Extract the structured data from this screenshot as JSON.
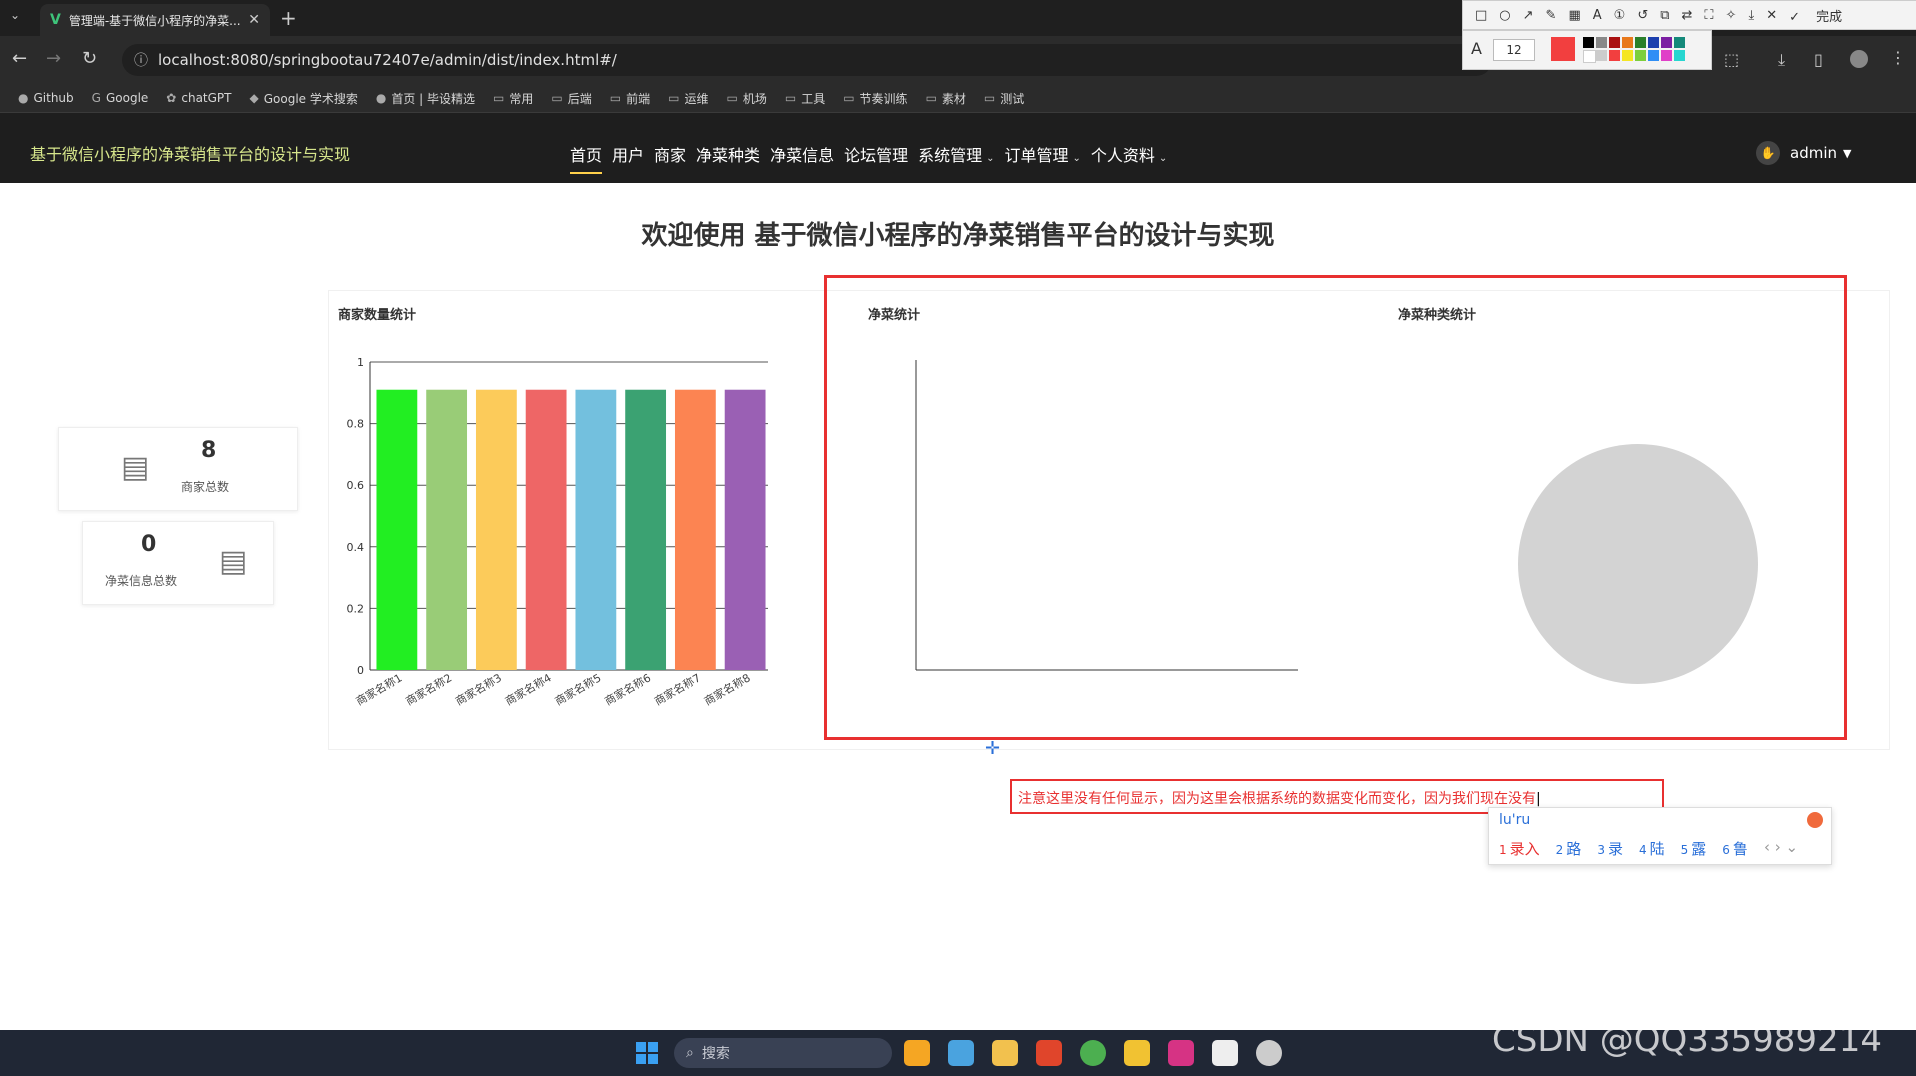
{
  "browser": {
    "tab_title": "管理端-基于微信小程序的净菜...",
    "tab_icon": "V",
    "url": "localhost:8080/springbootau72407e/admin/dist/index.html#/",
    "bookmarks": [
      "Github",
      "Google",
      "chatGPT",
      "Google 学术搜索",
      "首页 | 毕设精选",
      "常用",
      "后端",
      "前端",
      "运维",
      "机场",
      "工具",
      "节奏训练",
      "素材",
      "测试"
    ]
  },
  "annotation_tool": {
    "done_label": "完成",
    "font_size": "12"
  },
  "app": {
    "title": "基于微信小程序的净菜销售平台的设计与实现",
    "nav": [
      {
        "label": "首页",
        "dropdown": false,
        "active": true
      },
      {
        "label": "用户",
        "dropdown": false
      },
      {
        "label": "商家",
        "dropdown": false
      },
      {
        "label": "净菜种类",
        "dropdown": false
      },
      {
        "label": "净菜信息",
        "dropdown": false
      },
      {
        "label": "论坛管理",
        "dropdown": false
      },
      {
        "label": "系统管理",
        "dropdown": true
      },
      {
        "label": "订单管理",
        "dropdown": true
      },
      {
        "label": "个人资料",
        "dropdown": true
      }
    ],
    "user": "admin"
  },
  "main": {
    "welcome": "欢迎使用 基于微信小程序的净菜销售平台的设计与实现",
    "stats": [
      {
        "value": "8",
        "label": "商家总数"
      },
      {
        "value": "0",
        "label": "净菜信息总数"
      }
    ],
    "panels": {
      "merchant": "商家数量统计",
      "veg": "净菜统计",
      "vegtype": "净菜种类统计"
    },
    "note": "注意这里没有任何显示，因为这里会根据系统的数据变化而变化，因为我们现在没有",
    "ime": {
      "pinyin": "lu'ru",
      "candidates": [
        {
          "n": "1",
          "text": "录入"
        },
        {
          "n": "2",
          "text": "路"
        },
        {
          "n": "3",
          "text": "录"
        },
        {
          "n": "4",
          "text": "陆"
        },
        {
          "n": "5",
          "text": "露"
        },
        {
          "n": "6",
          "text": "鲁"
        }
      ]
    }
  },
  "chart_data": [
    {
      "type": "bar",
      "title": "商家数量统计",
      "categories": [
        "商家名称1",
        "商家名称2",
        "商家名称3",
        "商家名称4",
        "商家名称5",
        "商家名称6",
        "商家名称7",
        "商家名称8"
      ],
      "values": [
        1,
        1,
        1,
        1,
        1,
        1,
        1,
        1
      ],
      "colors": [
        "#22ee22",
        "#99cc77",
        "#fccb5a",
        "#ee6666",
        "#73c0de",
        "#3ba272",
        "#fc8452",
        "#9a60b4"
      ],
      "ylim": [
        0,
        1
      ],
      "yticks": [
        "0",
        "0.2",
        "0.4",
        "0.6",
        "0.8",
        "1"
      ],
      "grid": true
    },
    {
      "type": "line",
      "title": "净菜统计",
      "series": []
    },
    {
      "type": "pie",
      "title": "净菜种类统计",
      "values": [],
      "empty_color": "#d3d3d3"
    }
  ],
  "taskbar": {
    "search_placeholder": "搜索"
  },
  "watermark": "CSDN @QQ335989214"
}
